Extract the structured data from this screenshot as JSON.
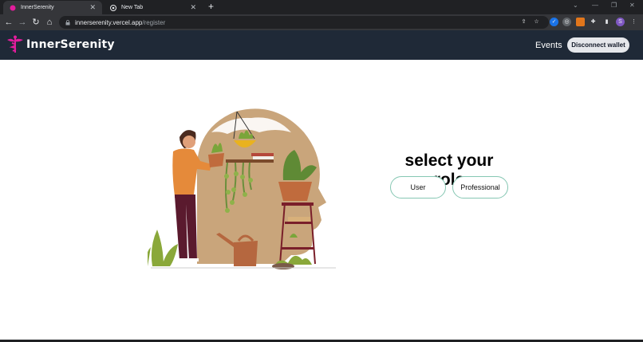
{
  "browser": {
    "tabs": [
      {
        "title": "InnerSerenity",
        "active": true
      },
      {
        "title": "New Tab",
        "active": false
      }
    ],
    "url_host": "innerserenity.vercel.app",
    "url_path": "/register",
    "profile_initial": "S"
  },
  "app": {
    "brand": "InnerSerenity",
    "nav_events": "Events",
    "disconnect_label": "Disconnect wallet"
  },
  "main": {
    "heading": "select your role",
    "roles": [
      "User",
      "Professional"
    ]
  },
  "colors": {
    "header_bg": "#1f2937",
    "logo_pink": "#e11d9c",
    "role_border": "#86c7b3"
  }
}
